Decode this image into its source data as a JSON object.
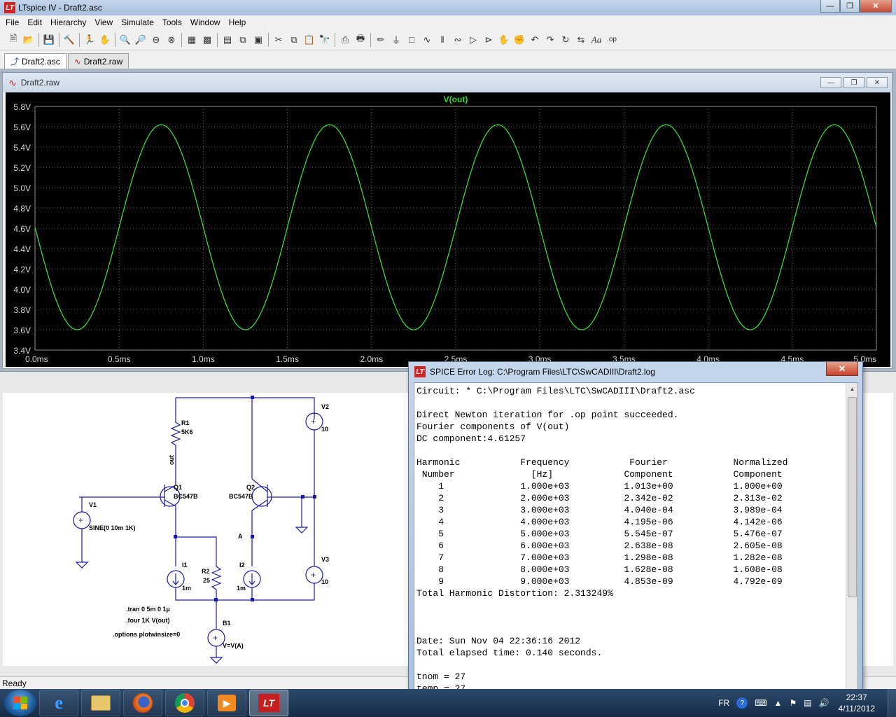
{
  "window": {
    "title": "LTspice IV - Draft2.asc"
  },
  "menu": [
    "File",
    "Edit",
    "Hierarchy",
    "View",
    "Simulate",
    "Tools",
    "Window",
    "Help"
  ],
  "tabs": [
    {
      "label": "Draft2.asc",
      "active": true
    },
    {
      "label": "Draft2.raw",
      "active": false
    }
  ],
  "plot_window": {
    "title": "Draft2.raw"
  },
  "status": {
    "text": "Ready"
  },
  "chart_data": {
    "type": "line",
    "title": "V(out)",
    "xlabel": "",
    "ylabel": "",
    "x_ticks": [
      "0.0ms",
      "0.5ms",
      "1.0ms",
      "1.5ms",
      "2.0ms",
      "2.5ms",
      "3.0ms",
      "3.5ms",
      "4.0ms",
      "4.5ms",
      "5.0ms"
    ],
    "y_ticks": [
      "3.4V",
      "3.6V",
      "3.8V",
      "4.0V",
      "4.2V",
      "4.4V",
      "4.6V",
      "4.8V",
      "5.0V",
      "5.2V",
      "5.4V",
      "5.6V",
      "5.8V"
    ],
    "xlim": [
      0,
      5
    ],
    "ylim": [
      3.4,
      5.8
    ],
    "grid": true,
    "series": [
      {
        "name": "V(out)",
        "color": "#33dd33",
        "function": "dc - amp*sin(2*pi*f*t)",
        "dc": 4.61,
        "amplitude": 1.01,
        "frequency_khz": 1
      }
    ]
  },
  "schematic": {
    "labels": {
      "r1": "R1",
      "r1_val": "5K6",
      "out": "out",
      "q1": "Q1",
      "q1_model": "BC547B",
      "q2": "Q2",
      "q2_model": "BC547B",
      "v1": "V1",
      "v1_val": "SINE(0 10m 1K)",
      "v2": "V2",
      "v2_val": "10",
      "v3": "V3",
      "v3_val": "10",
      "i1": "I1",
      "i1_val": "1m",
      "i2": "I2",
      "i2_val": "1m",
      "r2": "R2",
      "r2_val": "25",
      "node_a": "A",
      "b1": "B1",
      "b1_val": "V=V(A)",
      "dir_tran": ".tran 0 5m 0 1µ",
      "dir_four": ".four 1K V(out)",
      "dir_options": ".options plotwinsize=0"
    }
  },
  "log_window": {
    "title": "SPICE Error Log: C:\\Program Files\\LTC\\SwCADIII\\Draft2.log",
    "lines": [
      "Circuit: * C:\\Program Files\\LTC\\SwCADIII\\Draft2.asc",
      "",
      "Direct Newton iteration for .op point succeeded.",
      "Fourier components of V(out)",
      "DC component:4.61257",
      "",
      "Harmonic           Frequency           Fourier            Normalized",
      " Number              [Hz]             Component           Component",
      "    1              1.000e+03          1.013e+00           1.000e+00",
      "    2              2.000e+03          2.342e-02           2.313e-02",
      "    3              3.000e+03          4.040e-04           3.989e-04",
      "    4              4.000e+03          4.195e-06           4.142e-06",
      "    5              5.000e+03          5.545e-07           5.476e-07",
      "    6              6.000e+03          2.638e-08           2.605e-08",
      "    7              7.000e+03          1.298e-08           1.282e-08",
      "    8              8.000e+03          1.628e-08           1.608e-08",
      "    9              9.000e+03          4.853e-09           4.792e-09",
      "Total Harmonic Distortion: 2.313249%",
      "",
      "",
      "",
      "Date: Sun Nov 04 22:36:16 2012",
      "Total elapsed time: 0.140 seconds.",
      "",
      "tnom = 27",
      "temp = 27"
    ]
  },
  "taskbar": {
    "language": "FR",
    "time": "22:37",
    "date": "4/11/2012"
  }
}
